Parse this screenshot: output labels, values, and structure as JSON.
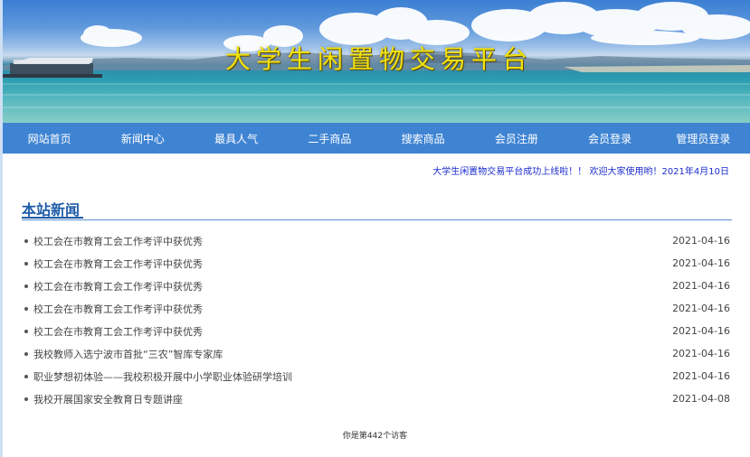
{
  "banner": {
    "title": "大学生闲置物交易平台"
  },
  "nav": {
    "items": [
      {
        "label": "网站首页"
      },
      {
        "label": "新闻中心"
      },
      {
        "label": "最具人气"
      },
      {
        "label": "二手商品"
      },
      {
        "label": "搜索商品"
      },
      {
        "label": "会员注册"
      },
      {
        "label": "会员登录"
      },
      {
        "label": "管理员登录"
      }
    ]
  },
  "announcement": "大学生闲置物交易平台成功上线啦！！ 欢迎大家使用哟！2021年4月10日",
  "news": {
    "heading": "本站新闻",
    "items": [
      {
        "title": "校工会在市教育工会工作考评中获优秀",
        "date": "2021-04-16"
      },
      {
        "title": "校工会在市教育工会工作考评中获优秀",
        "date": "2021-04-16"
      },
      {
        "title": "校工会在市教育工会工作考评中获优秀",
        "date": "2021-04-16"
      },
      {
        "title": "校工会在市教育工会工作考评中获优秀",
        "date": "2021-04-16"
      },
      {
        "title": "校工会在市教育工会工作考评中获优秀",
        "date": "2021-04-16"
      },
      {
        "title": "我校教师入选宁波市首批“三农”智库专家库",
        "date": "2021-04-16"
      },
      {
        "title": "职业梦想初体验——我校积极开展中小学职业体验研学培训",
        "date": "2021-04-16"
      },
      {
        "title": "我校开展国家安全教育日专题讲座",
        "date": "2021-04-08"
      }
    ]
  },
  "footer": {
    "visitors": "你是第442个访客"
  },
  "colors": {
    "nav_bg": "#3f84d3",
    "title_yellow": "#f2e10a",
    "heading_blue": "#1f5ca8",
    "marquee_blue": "#1a2ccc"
  }
}
